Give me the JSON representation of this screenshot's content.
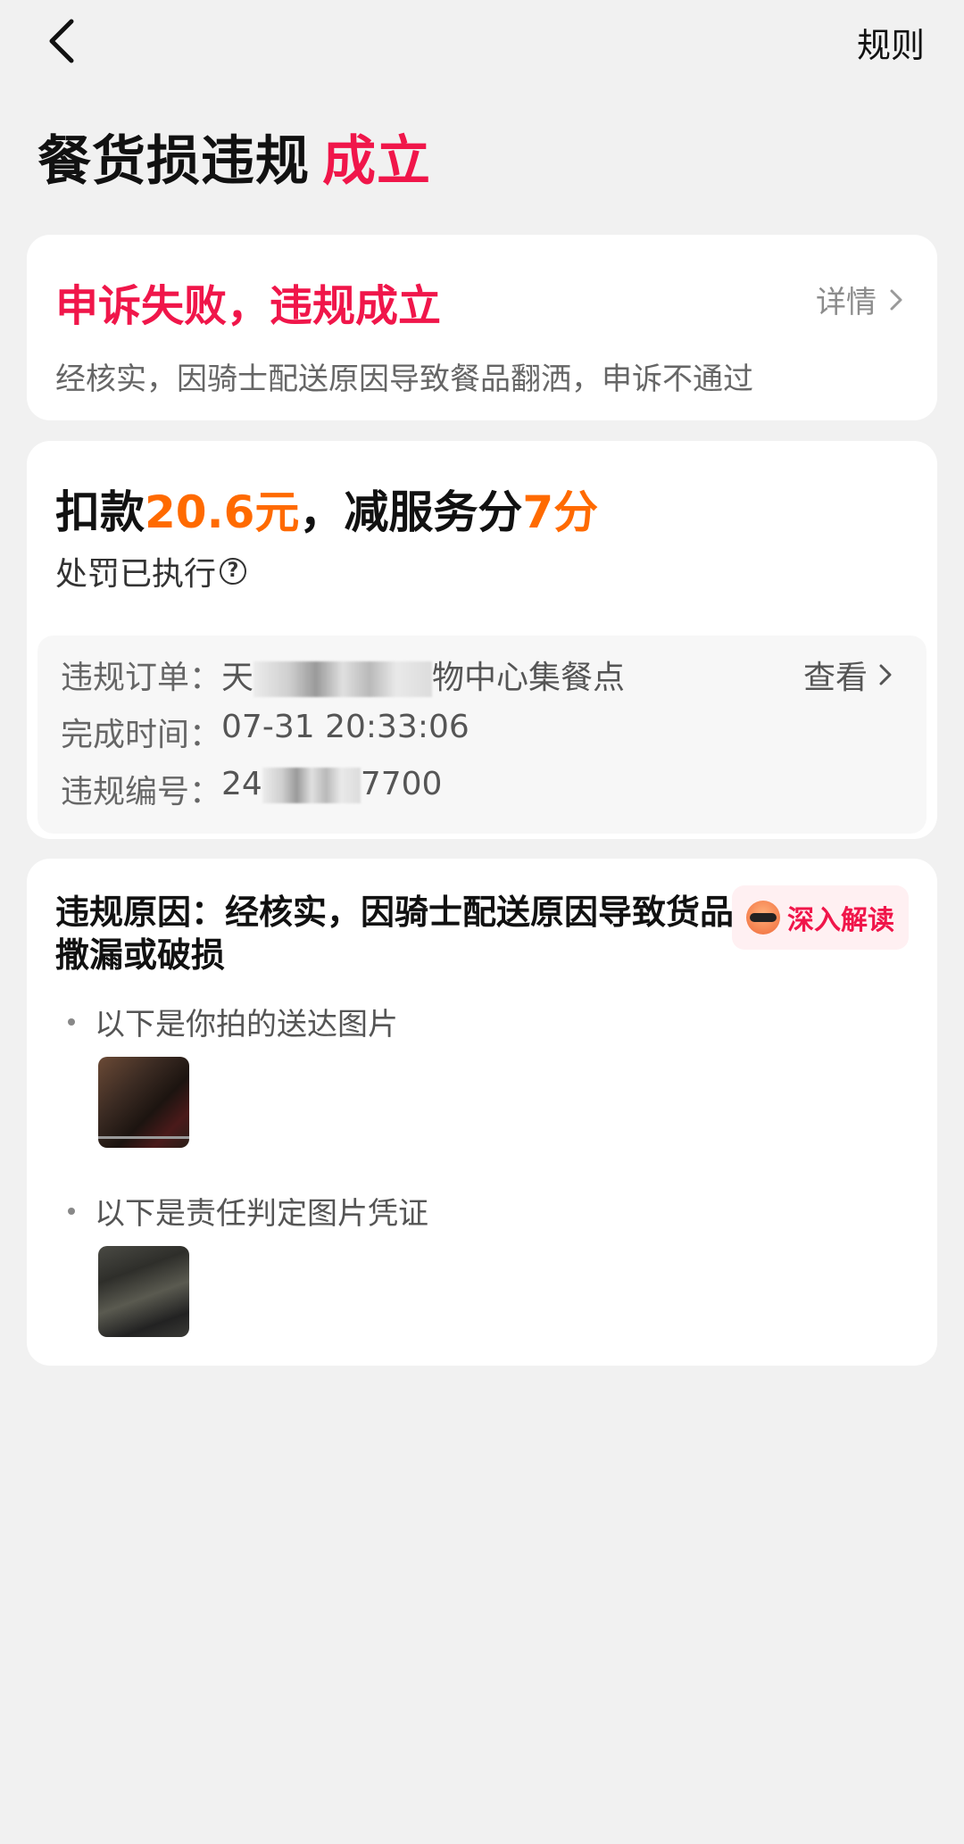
{
  "header": {
    "rules_label": "规则",
    "title_main": "餐货损违规",
    "title_status": "成立"
  },
  "appeal_card": {
    "title": "申诉失败，违规成立",
    "detail_label": "详情",
    "description": "经核实，因骑士配送原因导致餐品翻洒，申诉不通过"
  },
  "penalty_card": {
    "prefix": "扣款",
    "amount": "20.6元",
    "middle": "，减服务分",
    "score": "7分",
    "status": "处罚已执行",
    "help_icon_glyph": "?",
    "order_label": "违规订单：",
    "order_value_start": "天",
    "order_value_end": "物中心集餐点",
    "view_label": "查看",
    "time_label": "完成时间：",
    "time_value": "07-31 20:33:06",
    "number_label": "违规编号：",
    "number_value_start": "24",
    "number_value_end": "7700"
  },
  "reason_card": {
    "reason": "违规原因：经核实，因骑士配送原因导致货品撒漏或破损",
    "deep_button": "深入解读",
    "delivered_photos_label": "以下是你拍的送达图片",
    "evidence_photos_label": "以下是责任判定图片凭证"
  },
  "colors": {
    "accent_red": "#f0164a",
    "accent_orange": "#ff6a00",
    "background": "#f1f1f1"
  }
}
